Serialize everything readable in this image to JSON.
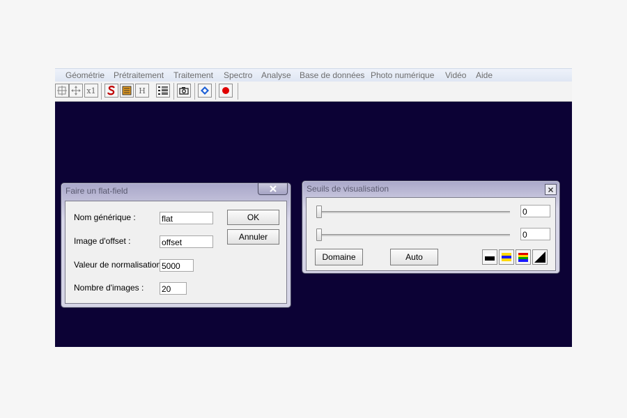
{
  "menu": [
    "Géométrie",
    "Prétraitement",
    "Traitement",
    "Spectro",
    "Analyse",
    "Base de données",
    "Photo numérique",
    "Vidéo",
    "Aide"
  ],
  "toolbar": {
    "icons": [
      "crosshair-icon",
      "move-icon",
      "zoom-x1-icon",
      "spectro-s-icon",
      "layers-icon",
      "histogram-h-icon",
      "list-icon",
      "camera-icon",
      "diamond-icon",
      "record-icon"
    ],
    "zoom_label": "x1",
    "h_label": "H"
  },
  "flatfield": {
    "title": "Faire un flat-field",
    "labels": [
      "Nom générique :",
      "Image d'offset :",
      "Valeur de normalisation :",
      "Nombre d'images :"
    ],
    "values": [
      "flat",
      "offset",
      "5000",
      "20"
    ],
    "ok": "OK",
    "cancel": "Annuler"
  },
  "seuils": {
    "title": "Seuils de visualisation",
    "high": "0",
    "low": "0",
    "domaine": "Domaine",
    "auto": "Auto",
    "palettes": [
      "grey-palette-icon",
      "blue-yellow-palette-icon",
      "rainbow-palette-icon",
      "gradient-palette-icon"
    ]
  },
  "colors": {
    "canvas": "#0c0235",
    "record_red": "#e00000",
    "spectro_red": "#c00000",
    "diamond_blue": "#1c5fd6"
  }
}
